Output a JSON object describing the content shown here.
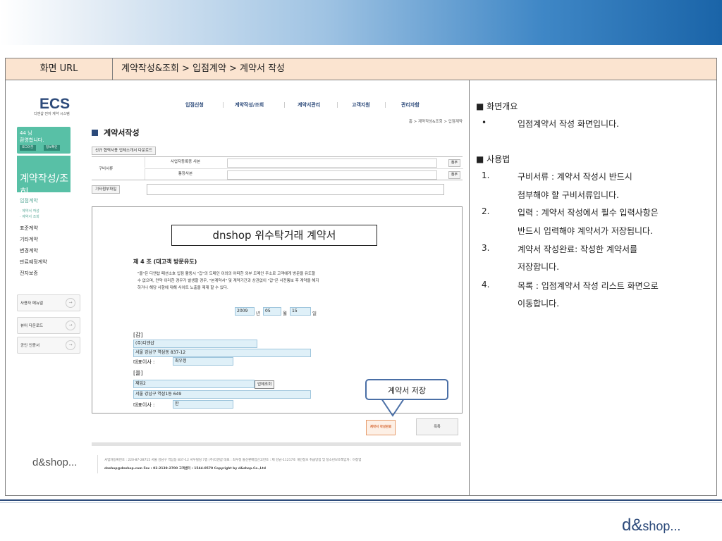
{
  "url_row": {
    "label": "화면 URL",
    "path": "계약작성&조회 > 입점계약 > 계약서 작성"
  },
  "screen": {
    "logo": "ECS",
    "logo_sub": "디앤샵 전자 계약 시스템",
    "top_nav": [
      "입점신청",
      "계약작성/조회",
      "계약서관리",
      "고객지원",
      "관리자함"
    ],
    "user": {
      "name": "44 님",
      "welcome": "환영합니다.",
      "logout": "로그아웃",
      "info": "정보확인"
    },
    "category": "계약작성/조회",
    "side_nav": [
      "입점계약",
      "· 계약서 작성",
      "· 계약서 조회",
      "표준계약",
      "기타계약",
      "변경계약",
      "만료예정계약",
      "전자보증"
    ],
    "side_buttons": [
      "사용자 메뉴얼",
      "뷰어 다운로드",
      "공인 인증서"
    ],
    "breadcrumb": "홈 > 계약작성&조회 > 입점계약",
    "page_title": "계약서작성",
    "download_btn": "신규 협력사용 업체소개서 다운로드",
    "docs_label": "구비서류",
    "doc1": "사업자등록증 사본",
    "doc2": "통장사본",
    "attach": "첨부",
    "other_attach": "기타첨부파일",
    "contract": {
      "title": "dnshop 위수탁거래 계약서",
      "article": "제 4 조 (대고객 방문유도)",
      "para1": "\"을\"은 디앤샵 패션소호 입점 활동시 \"갑\"의 도메인 이외의 어떠한 외부 도메인 주소로 고객에게 방문을 유도할",
      "para2": "수 없으며, 만약 이러한 경우가 발생할 경우, \"본계약서\" 및 계약기간과 상관없이 \"갑\"은 사전통보 후 계약을 해지",
      "para3": "하거나 해당 사항에 대해 사이트 노출을 제재 할 수 있다.",
      "year": "2009",
      "year_unit": "년",
      "month": "05",
      "month_unit": "월",
      "day": "15",
      "day_unit": "일",
      "party_a": "[갑]",
      "a_name": "(주)디앤샵",
      "a_addr": "서울 강남구 역삼동 837-12",
      "a_rep_label": "대표이사 :",
      "a_rep": "최우정",
      "party_b": "[을]",
      "b_name": "재입2",
      "biz_lookup": "업체조회",
      "b_addr": "서울 강남구 역삼1동 649",
      "b_rep_label": "대표이사 :",
      "b_rep": "한"
    },
    "callout": "계약서 저장",
    "save_btn": "계약서 작성완료",
    "list_btn": "목록",
    "footer_logo": "d&shop...",
    "footer_line1": "사업자등록번호 : 220-87-28715 서울 강남구 역삼동 837-12 서우빌딩 7층 (주)디앤샵 대표 : 최우정 통신판매업신고번호 : 제 강남-11217호 개인정보 취급방침 및 청소년보호책임자 : 이정엽",
    "footer_line2": "dnshop@dnshop.com Fax : 02-2139-2700 고객센터 : 1544-0570 Copyright by d&shop.Co.,Ltd"
  },
  "description": {
    "overview_title": "■ 화면개요",
    "overview_items": [
      {
        "marker": "•",
        "text": "입점계약서 작성 화면입니다."
      }
    ],
    "usage_title": "■ 사용법",
    "usage_lines": [
      {
        "marker": "1.",
        "text": "구비서류 : 계약서 작성시 반드시"
      },
      {
        "marker": "",
        "text": "첨부해야 할 구비서류입니다."
      },
      {
        "marker": "2.",
        "text": "입력 : 계약서 작성에서 필수 입력사항은"
      },
      {
        "marker": "",
        "text": "반드시 입력해야 계약서가 저장됩니다."
      },
      {
        "marker": "3.",
        "text": "계약서 작성완료: 작성한 계약서를"
      },
      {
        "marker": "",
        "text": "저장합니다."
      },
      {
        "marker": "4.",
        "text": "목록 : 입점계약서 작성 리스트 화면으로"
      },
      {
        "marker": "",
        "text": "이동합니다."
      }
    ]
  },
  "bottom_logo": {
    "main": "d&",
    "rest": "shop..."
  },
  "colors": {
    "accent": "#58c0a6",
    "navy": "#2c4a7a",
    "url_bg": "#fbe4d0",
    "callout": "#4a6fa6"
  }
}
